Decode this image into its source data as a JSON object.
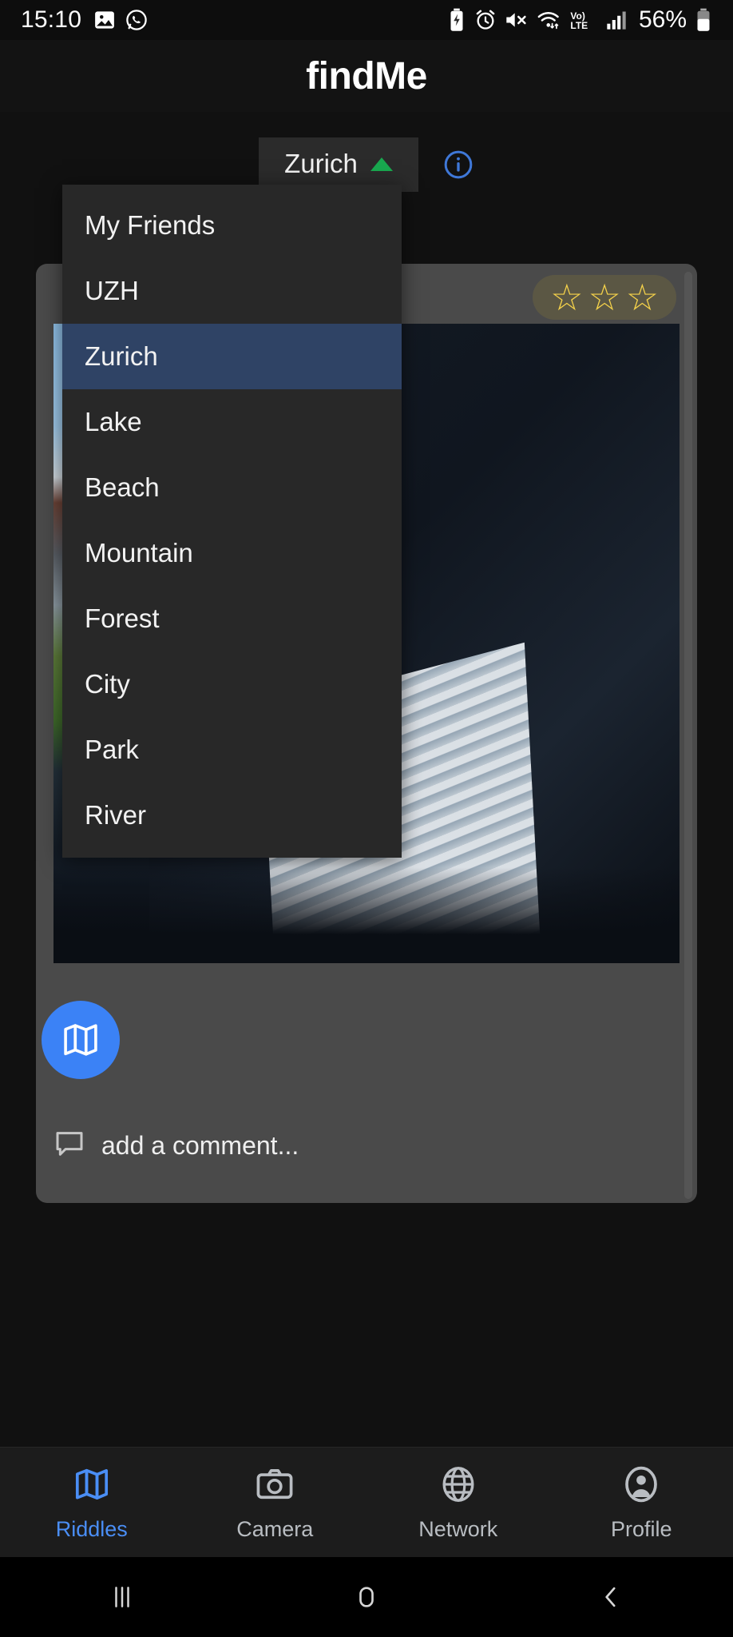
{
  "status_bar": {
    "time": "15:10",
    "left_icons": [
      "image-icon",
      "whatsapp-icon"
    ],
    "right_icons": [
      "battery-saver-icon",
      "alarm-icon",
      "mute-icon",
      "wifi-icon",
      "volte-icon",
      "signal-icon"
    ],
    "battery_percent": "56%"
  },
  "header": {
    "title": "findMe"
  },
  "filter": {
    "selected_value": "Zurich",
    "caret": "caret-up-green",
    "info_icon": "info-icon",
    "options": [
      "My Friends",
      "UZH",
      "Zurich",
      "Lake",
      "Beach",
      "Mountain",
      "Forest",
      "City",
      "Park",
      "River"
    ],
    "selected_index": 2
  },
  "card": {
    "rating": {
      "star_glyph": "☆",
      "count": 3,
      "color": "#f5d24a"
    },
    "photo_alt": "window-with-blinds-photo",
    "map_button_icon": "map-icon",
    "map_button_color": "#3b82f6",
    "comment_icon": "comment-bubble-icon",
    "comment_placeholder": "add a comment..."
  },
  "bottom_nav": {
    "active_color": "#4a8ef5",
    "items": [
      {
        "label": "Riddles",
        "icon": "map-icon",
        "active": true
      },
      {
        "label": "Camera",
        "icon": "camera-icon",
        "active": false
      },
      {
        "label": "Network",
        "icon": "globe-icon",
        "active": false
      },
      {
        "label": "Profile",
        "icon": "person-circle-icon",
        "active": false
      }
    ]
  },
  "system_nav": {
    "recents": "recents-icon",
    "home": "home-icon",
    "back": "back-icon"
  }
}
